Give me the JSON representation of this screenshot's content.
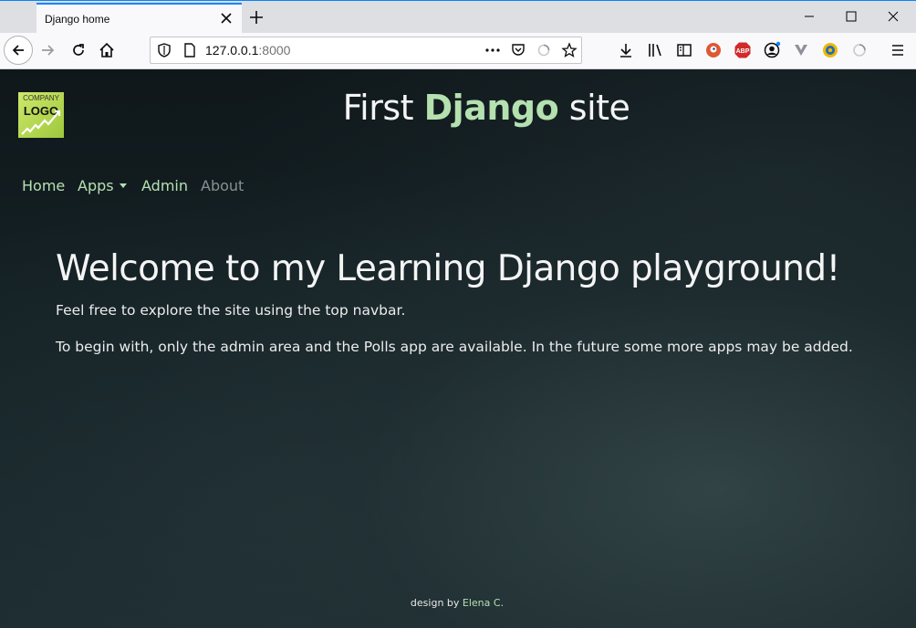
{
  "browser": {
    "tab_title": "Django home",
    "url_host": "127.0.0.1",
    "url_port": ":8000",
    "icons": [
      "back-icon",
      "forward-icon",
      "reload-icon",
      "home-icon",
      "shield-icon",
      "page-icon",
      "more-icon",
      "pocket-icon",
      "loading-icon",
      "bookmark-star-icon",
      "download-icon",
      "library-icon",
      "sidebar-icon",
      "duckduckgo-icon",
      "adblock-icon",
      "account-icon",
      "vivaldi-icon",
      "extension-icon",
      "loading-icon",
      "menu-icon"
    ],
    "extensions": {
      "adblock_label": "ABP"
    }
  },
  "site": {
    "logo": {
      "line1": "COMPANY",
      "line2": "LOGO"
    },
    "title_prefix": "First ",
    "title_accent": "Django",
    "title_suffix": " site",
    "accent_color": "#b5e0b0",
    "nav": {
      "home": "Home",
      "apps": "Apps",
      "admin": "Admin",
      "about": "About"
    }
  },
  "main": {
    "heading": "Welcome to my Learning Django playground!",
    "para1": "Feel free to explore the site using the top navbar.",
    "para2": "To begin with, only the admin area and the Polls app are available. In the future some more apps may be added."
  },
  "footer": {
    "prefix": "design by ",
    "author": "Elena C."
  }
}
